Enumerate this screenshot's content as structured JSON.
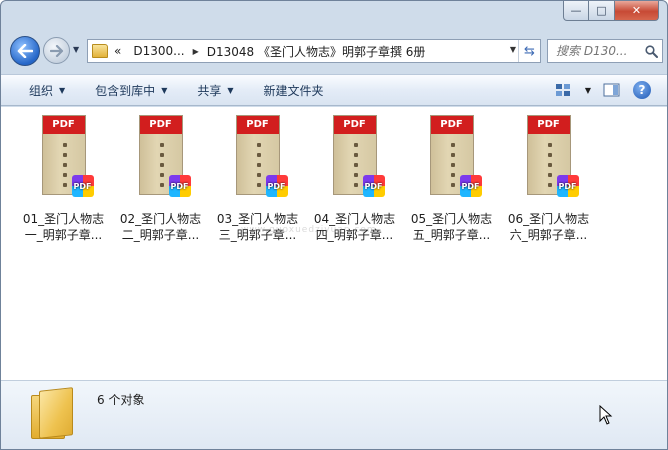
{
  "window": {
    "caption": {
      "minimize": "—",
      "maximize": "□",
      "close": "✕"
    }
  },
  "nav": {
    "back": "back",
    "forward": "forward",
    "breadcrumb": {
      "overflow": "«",
      "parent": "D1300...",
      "current": "D13048 《圣门人物志》明郭子章撰 6册"
    },
    "search_placeholder": "搜索 D130..."
  },
  "toolbar": {
    "organize": "组织",
    "include_library": "包含到库中",
    "share": "共享",
    "new_folder": "新建文件夹"
  },
  "files": [
    {
      "line1": "01_圣门人物志",
      "line2": "一_明郭子章...",
      "cover": "PDF",
      "badge": "PDF"
    },
    {
      "line1": "02_圣门人物志",
      "line2": "二_明郭子章...",
      "cover": "PDF",
      "badge": "PDF"
    },
    {
      "line1": "03_圣门人物志",
      "line2": "三_明郭子章...",
      "cover": "PDF",
      "badge": "PDF"
    },
    {
      "line1": "04_圣门人物志",
      "line2": "四_明郭子章...",
      "cover": "PDF",
      "badge": "PDF"
    },
    {
      "line1": "05_圣门人物志",
      "line2": "五_明郭子章...",
      "cover": "PDF",
      "badge": "PDF"
    },
    {
      "line1": "06_圣门人物志",
      "line2": "六_明郭子章...",
      "cover": "PDF",
      "badge": "PDF"
    }
  ],
  "watermark": "www.guoxuedziyuan.com",
  "details": {
    "count": "6 个对象"
  },
  "colors": {
    "pdf_band": "#d21e1e",
    "window_frame": "#cfdcea",
    "accent": "#2566c8"
  }
}
